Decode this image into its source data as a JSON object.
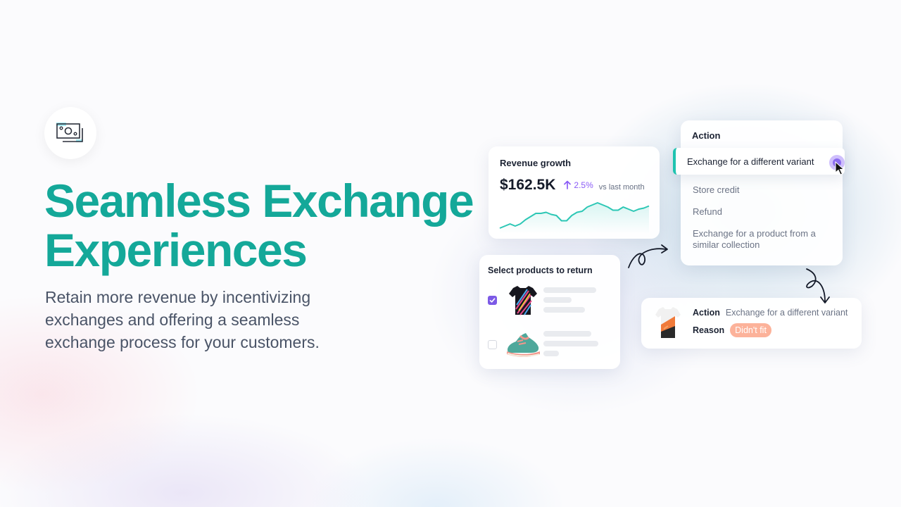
{
  "hero": {
    "title_line1": "Seamless Exchange",
    "title_line2": "Experiences",
    "subtitle_line1": "Retain more revenue by incentivizing",
    "subtitle_line2": "exchanges and offering a seamless",
    "subtitle_line3": "exchange process for your customers.",
    "logo_icon": "money-bills-icon"
  },
  "revenue_card": {
    "title": "Revenue growth",
    "value": "$162.5K",
    "change": "2.5%",
    "change_icon": "arrow-up-icon",
    "comparison": "vs last month",
    "sparkline_points_relative": [
      4,
      6,
      8,
      6,
      8,
      12,
      15,
      18,
      18,
      19,
      17,
      16,
      11,
      11,
      16,
      19,
      20,
      24,
      26,
      28,
      26,
      24,
      21,
      21,
      24,
      22,
      20,
      22,
      23,
      25
    ],
    "accent_color": "#2cc7b5",
    "change_color": "#8b5cf6"
  },
  "action_menu": {
    "title": "Action",
    "selected": "Exchange for a different variant",
    "options": [
      "Store credit",
      "Refund",
      "Exchange for a product from a similar collection"
    ],
    "accent_color": "#1fc3b0"
  },
  "select_products": {
    "title": "Select products to return",
    "items": [
      {
        "name": "jersey-product",
        "checked": true
      },
      {
        "name": "sneaker-product",
        "checked": false
      }
    ],
    "checkbox_color": "#7c5ae6"
  },
  "result_card": {
    "action_label": "Action",
    "action_value": "Exchange for a different variant",
    "reason_label": "Reason",
    "reason_value": "Didn't fit",
    "badge_color": "#fcb29a"
  }
}
